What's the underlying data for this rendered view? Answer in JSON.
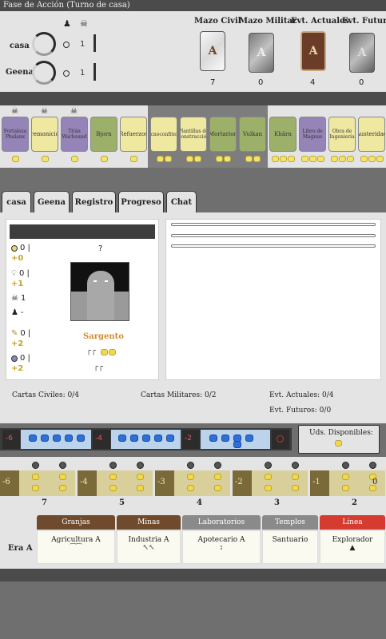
{
  "header": {
    "phase_title": "Fase de Acción (Turno de casa)"
  },
  "players": [
    {
      "name": "casa",
      "value_a": "0",
      "value_b": "1"
    },
    {
      "name": "Geena",
      "value_a": "0",
      "value_b": "1"
    }
  ],
  "decks": [
    {
      "title": "Mazo Civil",
      "letter": "A",
      "count": "7"
    },
    {
      "title": "Mazo Militar",
      "letter": "A",
      "count": "0"
    },
    {
      "title": "Evt. Actuales",
      "letter": "A",
      "count": "4"
    },
    {
      "title": "Evt. Futuros",
      "letter": "A",
      "count": "0"
    }
  ],
  "card_row": [
    {
      "name": "Fortaleza Phalanx",
      "color": "purple",
      "coins": 1,
      "pawn": true
    },
    {
      "name": "Premonición",
      "color": "yellow",
      "coins": 1,
      "pawn": true
    },
    {
      "name": "Titán Warhound",
      "color": "purple",
      "coins": 1,
      "pawn": true
    },
    {
      "name": "Bjorn",
      "color": "green",
      "coins": 1,
      "pawn": false
    },
    {
      "name": "Refuerzos",
      "color": "yellow",
      "coins": 1,
      "pawn": false
    },
    {
      "name": "Tecnoconfiteria",
      "color": "yellow",
      "coins": 2,
      "pawn": false
    },
    {
      "name": "Plantillas de Construcción",
      "color": "yellow",
      "coins": 2,
      "pawn": false
    },
    {
      "name": "Mortarion",
      "color": "green",
      "coins": 2,
      "pawn": false
    },
    {
      "name": "Vulkan",
      "color": "green",
      "coins": 2,
      "pawn": false
    },
    {
      "name": "Khârn",
      "color": "green",
      "coins": 3,
      "pawn": false
    },
    {
      "name": "Libro de Magnus",
      "color": "purple",
      "coins": 3,
      "pawn": false
    },
    {
      "name": "Obra de Ingeniería",
      "color": "yellow",
      "coins": 3,
      "pawn": false
    },
    {
      "name": "Austeridad",
      "color": "yellow",
      "coins": 3,
      "pawn": false
    }
  ],
  "tabs": [
    "casa",
    "Geena",
    "Registro",
    "Progreso",
    "Chat"
  ],
  "player_panel": {
    "stat1": "0 |",
    "stat1_bonus": "+0",
    "stat2": "0 |",
    "stat2_bonus": "+1",
    "stat3": "1",
    "stat4": "-",
    "stat5": "0 |",
    "stat5_bonus": "+2",
    "stat6": "0 |",
    "stat6_bonus": "+2",
    "question": "?",
    "leader": "Sargento"
  },
  "counts": {
    "civil": "Cartas Civiles: 0/4",
    "military": "Cartas Militares: 0/2",
    "current_events": "Evt. Actuales: 0/4",
    "future_events": "Evt. Futuros: 0/0"
  },
  "military": {
    "labels": [
      "-6",
      "-4",
      "-2",
      "0"
    ],
    "uds_label": "Uds. Disponibles:"
  },
  "track": {
    "minus": [
      "-6",
      "-4",
      "-3",
      "-2",
      "-1"
    ],
    "numbers": [
      "7",
      "5",
      "4",
      "3",
      "2"
    ],
    "end_label": "0"
  },
  "buildings": {
    "era_label": "Era A",
    "headers": [
      {
        "label": "Granjas",
        "color": "#6f4a2c"
      },
      {
        "label": "Minas",
        "color": "#6f4a2c"
      },
      {
        "label": "Laboratorios",
        "color": "#8a8a8a"
      },
      {
        "label": "Templos",
        "color": "#8a8a8a"
      },
      {
        "label": "Línea",
        "color": "#d63b2f"
      }
    ],
    "cells": [
      {
        "name": "Agricultura A",
        "sub": "⁀⁀"
      },
      {
        "name": "Industria A",
        "sub": "↖↖"
      },
      {
        "name": "Apotecario A",
        "sub": "⦂"
      },
      {
        "name": "Santuario",
        "sub": ""
      },
      {
        "name": "Explorador",
        "sub": "▲"
      }
    ]
  }
}
